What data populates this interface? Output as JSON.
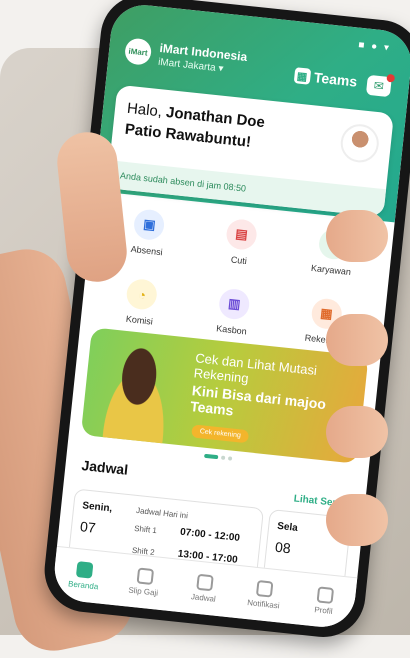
{
  "app": {
    "store_name": "iMart Indonesia",
    "store_city": "iMart Jakarta",
    "brand": "Teams",
    "logo_text": "iMart"
  },
  "greeting": {
    "hello": "Halo,",
    "name": "Jonathan Doe Patio Rawabuntu!",
    "attendance": "Anda sudah absen di jam 08:50"
  },
  "menu": [
    {
      "label": "Absensi",
      "icon": "attendance-icon",
      "color": "#2f6fdb",
      "bg": "#e6efff"
    },
    {
      "label": "Cuti",
      "icon": "leave-icon",
      "color": "#d94444",
      "bg": "#fde8e8"
    },
    {
      "label": "Karyawan",
      "icon": "employee-icon",
      "color": "#2f9d6a",
      "bg": "#e5f6ec"
    },
    {
      "label": "Komisi",
      "icon": "commission-icon",
      "color": "#e3b31a",
      "bg": "#fff6d6"
    },
    {
      "label": "Kasbon",
      "icon": "cash-advance-icon",
      "color": "#6b4bd6",
      "bg": "#efe9ff"
    },
    {
      "label": "Rekening",
      "icon": "bank-account-icon",
      "color": "#e06b2c",
      "bg": "#ffeadd"
    }
  ],
  "banner": {
    "line1": "Cek dan Lihat Mutasi Rekening",
    "line2": "Kini Bisa dari majoo Teams",
    "button": "Cek rekening"
  },
  "schedule": {
    "title": "Jadwal",
    "see_all": "Lihat Semua",
    "card1": {
      "day": "Senin,",
      "date": "07",
      "today_label": "Jadwal Hari ini",
      "shift1": "Shift 1",
      "time1": "07:00 - 12:00",
      "shift2": "Shift 2",
      "time2": "13:00 - 17:00"
    },
    "card2": {
      "day": "Sela",
      "date": "08"
    }
  },
  "nav": [
    {
      "label": "Beranda",
      "icon": "home-icon",
      "active": true
    },
    {
      "label": "Slip Gaji",
      "icon": "payslip-icon",
      "active": false
    },
    {
      "label": "Jadwal",
      "icon": "calendar-icon",
      "active": false
    },
    {
      "label": "Notifikasi",
      "icon": "bell-icon",
      "active": false
    },
    {
      "label": "Profil",
      "icon": "profile-icon",
      "active": false
    }
  ],
  "colors": {
    "primary": "#2fae86",
    "header_start": "#3f9e63"
  }
}
